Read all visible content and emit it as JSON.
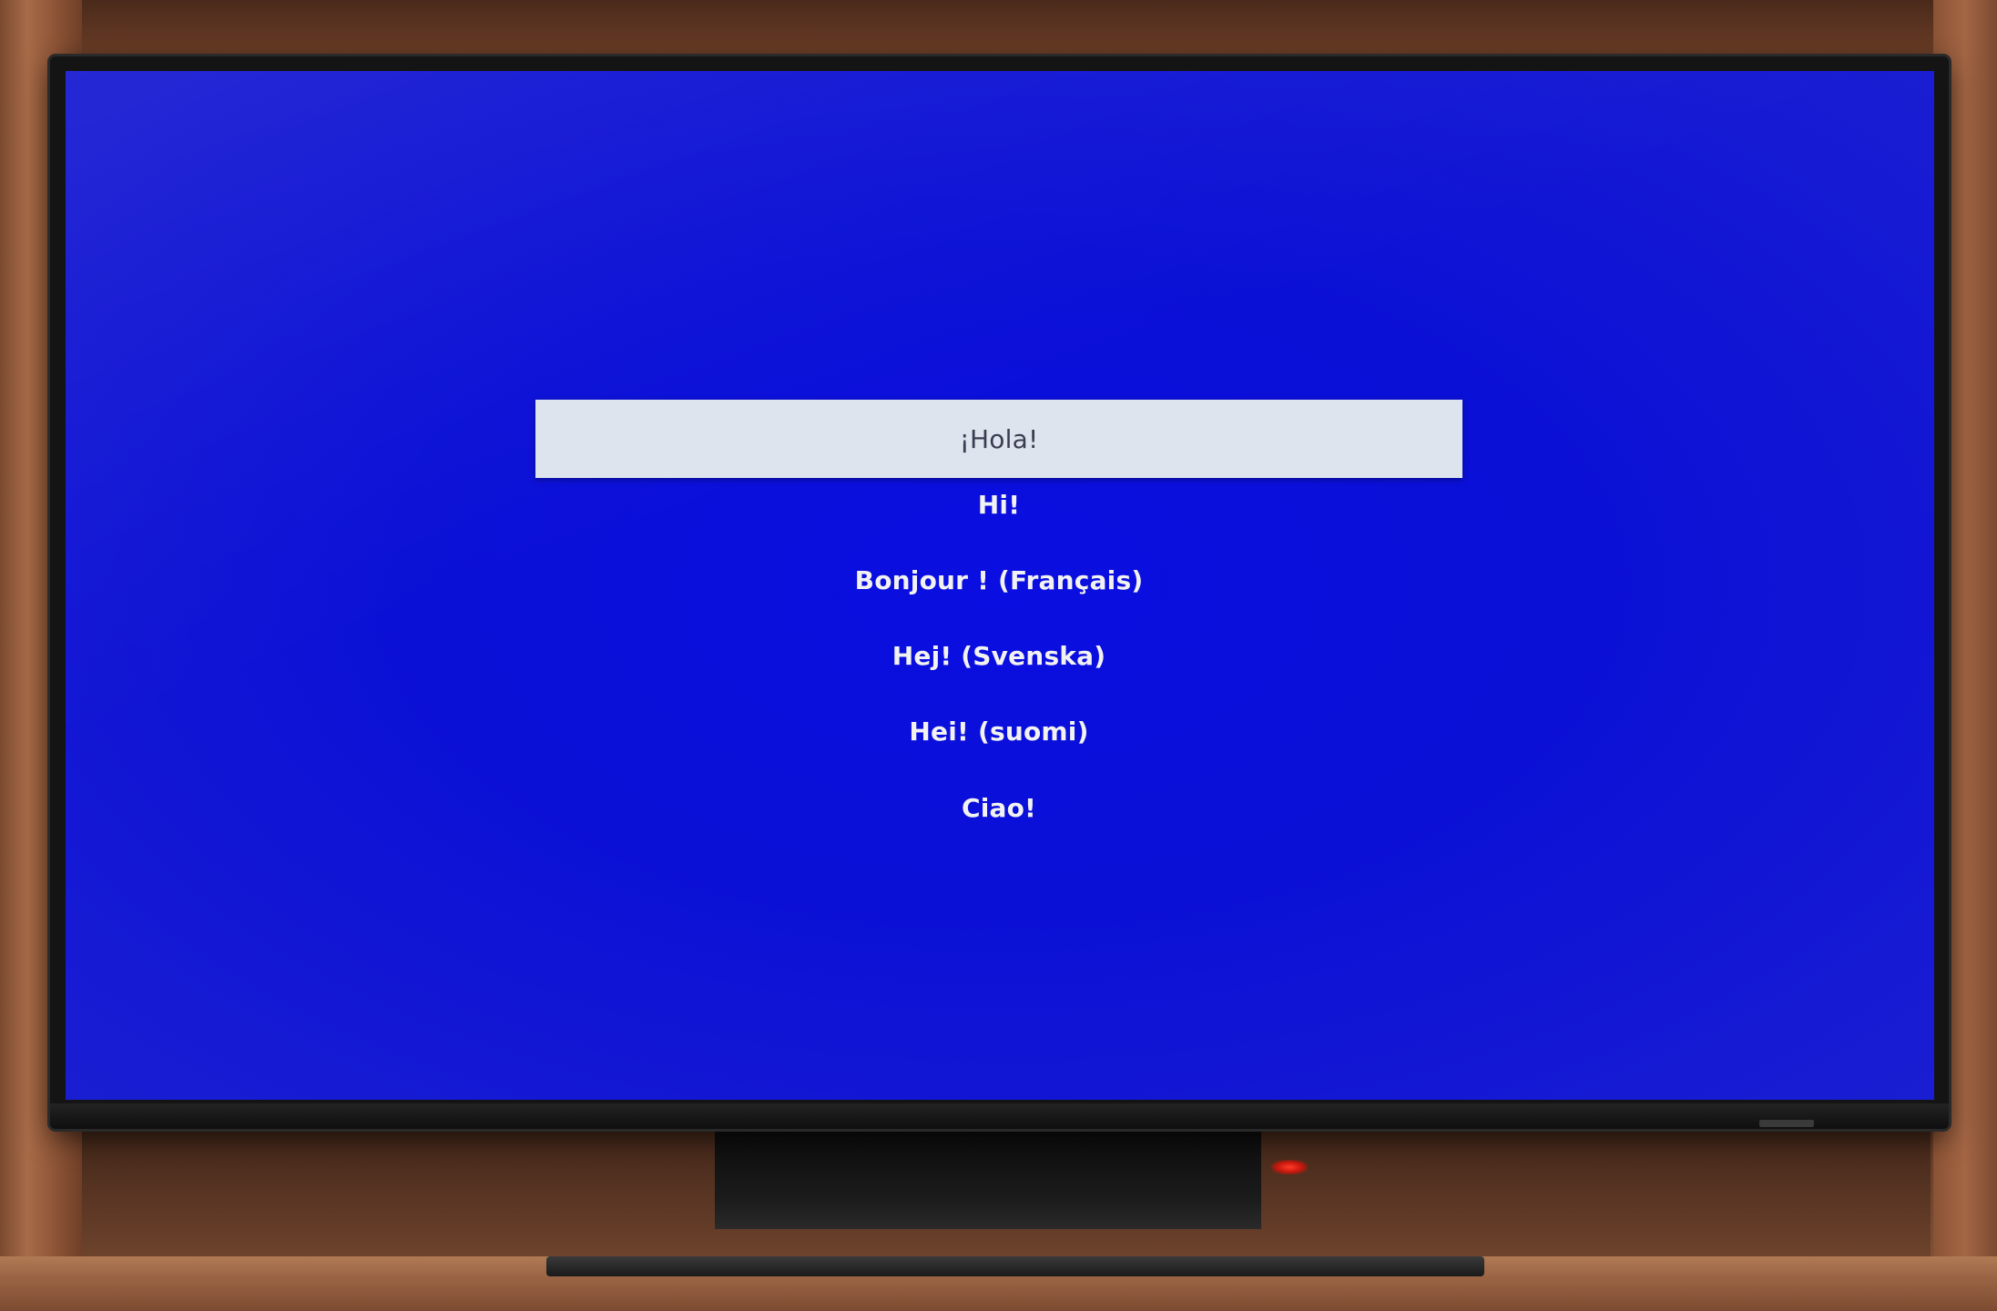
{
  "language_menu": {
    "items": [
      {
        "label": "¡Hola!",
        "selected": true
      },
      {
        "label": "Hi!",
        "selected": false
      },
      {
        "label": "Bonjour ! (Français)",
        "selected": false
      },
      {
        "label": "Hej! (Svenska)",
        "selected": false
      },
      {
        "label": "Hei! (suomi)",
        "selected": false
      },
      {
        "label": "Ciao!",
        "selected": false
      }
    ]
  },
  "colors": {
    "screen_background": "#0b10d6",
    "selected_item_background": "#dde4ee",
    "item_text": "#f2f2f2",
    "selected_item_text": "#3c3c50",
    "power_led": "#ff3b2a"
  }
}
